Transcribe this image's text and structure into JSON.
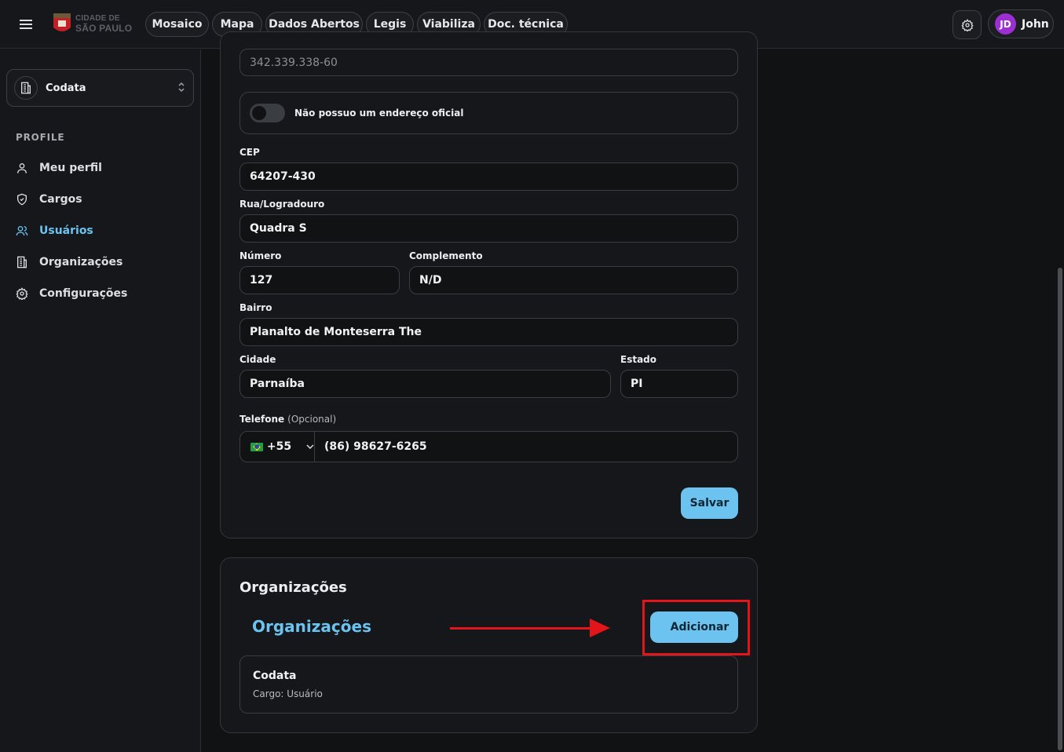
{
  "topbar": {
    "logo_line1": "CIDADE DE",
    "logo_line2": "SÃO PAULO",
    "nav": [
      "Mosaico",
      "Mapa",
      "Dados Abertos",
      "Legis",
      "Viabiliza",
      "Doc. técnica"
    ],
    "user_initials": "JD",
    "user_name": "John"
  },
  "sidebar": {
    "org_selector": "Codata",
    "section": "PROFILE",
    "items": [
      {
        "label": "Meu perfil",
        "icon": "user-icon"
      },
      {
        "label": "Cargos",
        "icon": "shield-icon"
      },
      {
        "label": "Usuários",
        "icon": "users-icon",
        "active": true
      },
      {
        "label": "Organizações",
        "icon": "building-icon"
      },
      {
        "label": "Configurações",
        "icon": "gear-icon"
      }
    ]
  },
  "form": {
    "cpf_value": "342.339.338-60",
    "no_address_toggle": "Não possuo um endereço oficial",
    "cep_label": "CEP",
    "cep_value": "64207-430",
    "street_label": "Rua/Logradouro",
    "street_value": "Quadra S",
    "number_label": "Número",
    "number_value": "127",
    "complement_label": "Complemento",
    "complement_value": "N/D",
    "district_label": "Bairro",
    "district_value": "Planalto de Monteserra The",
    "city_label": "Cidade",
    "city_value": "Parnaíba",
    "state_label": "Estado",
    "state_value": "PI",
    "phone_label": "Telefone",
    "phone_optional": "(Opcional)",
    "phone_country_code": "+55",
    "phone_value": "(86) 98627-6265",
    "save_label": "Salvar"
  },
  "organizations": {
    "card_title": "Organizações",
    "subtitle": "Organizações",
    "add_label": "Adicionar",
    "items": [
      {
        "name": "Codata",
        "role": "Cargo: Usuário"
      }
    ]
  },
  "colors": {
    "accent": "#6cc3ef",
    "annotation": "#e3151a",
    "avatar": "#9b2fd1"
  }
}
